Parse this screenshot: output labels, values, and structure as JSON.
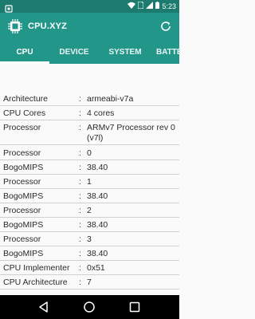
{
  "status_bar": {
    "time": "5:23",
    "icons": [
      "notification-chip-icon",
      "wifi-icon",
      "sim-icon",
      "signal-icon",
      "battery-icon"
    ]
  },
  "app_bar": {
    "title": "CPU.XYZ",
    "refresh_icon": "refresh-icon"
  },
  "tabs": [
    {
      "label": "CPU",
      "active": true
    },
    {
      "label": "DEVICE",
      "active": false
    },
    {
      "label": "SYSTEM",
      "active": false
    },
    {
      "label": "BATTERY",
      "active": false
    }
  ],
  "separator": ":",
  "info_rows": [
    {
      "label": "Architecture",
      "value": "armeabi-v7a"
    },
    {
      "label": "CPU Cores",
      "value": "4 cores"
    },
    {
      "label": "Processor",
      "value": "ARMv7 Processor rev 0 (v7l)"
    },
    {
      "label": "Processor",
      "value": "0"
    },
    {
      "label": "BogoMIPS",
      "value": "38.40"
    },
    {
      "label": "Processor",
      "value": "1"
    },
    {
      "label": "BogoMIPS",
      "value": "38.40"
    },
    {
      "label": "Processor",
      "value": "2"
    },
    {
      "label": "BogoMIPS",
      "value": "38.40"
    },
    {
      "label": "Processor",
      "value": "3"
    },
    {
      "label": "BogoMIPS",
      "value": "38.40"
    },
    {
      "label": "CPU Implementer",
      "value": "0x51"
    },
    {
      "label": "CPU Architecture",
      "value": "7"
    }
  ],
  "colors": {
    "status_bar": "#1d7a6e",
    "app_bar": "#23968a",
    "background": "#fafafa",
    "text": "#2a2a2a"
  }
}
